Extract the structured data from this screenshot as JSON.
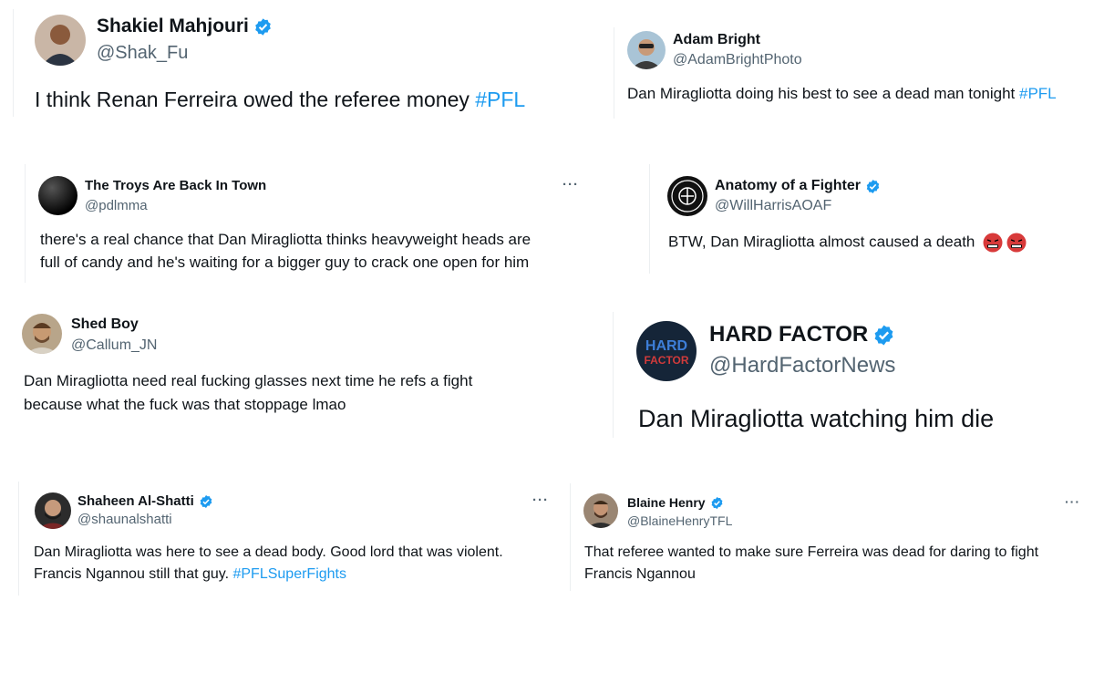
{
  "colors": {
    "hashtag": "#1d9bf0",
    "verified": "#1d9bf0",
    "handle": "#536471",
    "text": "#0f1419"
  },
  "tweets": [
    {
      "name": "Shakiel Mahjouri",
      "handle": "@Shak_Fu",
      "verified": true,
      "text": "I think Renan Ferreira owed the referee money ",
      "hashtag": "#PFL"
    },
    {
      "name": "Adam Bright",
      "handle": "@AdamBrightPhoto",
      "verified": false,
      "text": "Dan Miragliotta doing his best to see a dead man tonight ",
      "hashtag": "#PFL"
    },
    {
      "name": "The Troys Are Back In Town",
      "handle": "@pdlmma",
      "verified": false,
      "more": "···",
      "line1": "there's a real chance that Dan Miragliotta thinks heavyweight heads are",
      "line2": "full of candy and he's waiting for a bigger guy to crack one open for him"
    },
    {
      "name": "Anatomy of a Fighter",
      "handle": "@WillHarrisAOAF",
      "verified": true,
      "text": "BTW, Dan Miragliotta almost caused a death",
      "emoji": "angry-face-with-symbols-icon"
    },
    {
      "name": "Shed Boy",
      "handle": "@Callum_JN",
      "verified": false,
      "line1": "Dan Miragliotta need real fucking glasses next time he refs a fight",
      "line2": "because what the fuck was that stoppage lmao"
    },
    {
      "name": "HARD FACTOR",
      "handle": "@HardFactorNews",
      "verified": true,
      "avatar_text_top": "HARD",
      "avatar_text_bottom": "FACTOR",
      "text": "Dan Miragliotta watching him die"
    },
    {
      "name": "Shaheen Al-Shatti",
      "handle": "@shaunalshatti",
      "verified": true,
      "more": "···",
      "line1": "Dan Miragliotta was here to see a dead body. Good lord that was violent.",
      "line2": "Francis Ngannou still that guy. ",
      "hashtag": "#PFLSuperFights"
    },
    {
      "name": "Blaine Henry",
      "handle": "@BlaineHenryTFL",
      "verified": true,
      "more": "···",
      "line1": "That referee wanted to make sure Ferreira was dead for daring to fight",
      "line2": "Francis Ngannou"
    }
  ]
}
